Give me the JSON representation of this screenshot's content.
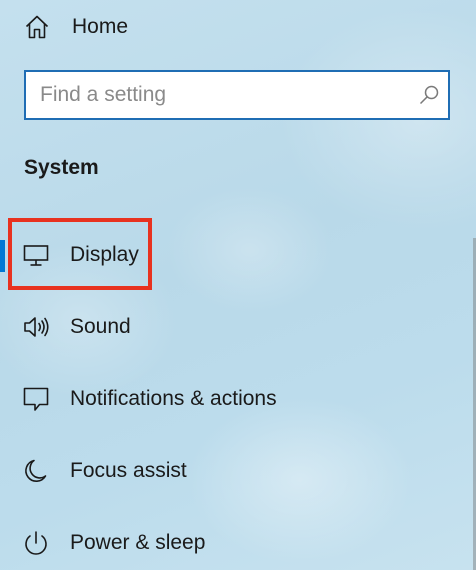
{
  "home": {
    "label": "Home",
    "icon": "home-icon"
  },
  "search": {
    "placeholder": "Find a setting",
    "value": "",
    "icon": "search-icon"
  },
  "section": {
    "title": "System"
  },
  "nav_items": [
    {
      "label": "Display",
      "icon": "monitor-icon",
      "selected": true
    },
    {
      "label": "Sound",
      "icon": "speaker-icon",
      "selected": false
    },
    {
      "label": "Notifications & actions",
      "icon": "notification-icon",
      "selected": false
    },
    {
      "label": "Focus assist",
      "icon": "moon-icon",
      "selected": false
    },
    {
      "label": "Power & sleep",
      "icon": "power-icon",
      "selected": false
    }
  ],
  "colors": {
    "accent": "#0078d4",
    "search_border": "#1f6db4",
    "highlight": "#e8321f"
  }
}
